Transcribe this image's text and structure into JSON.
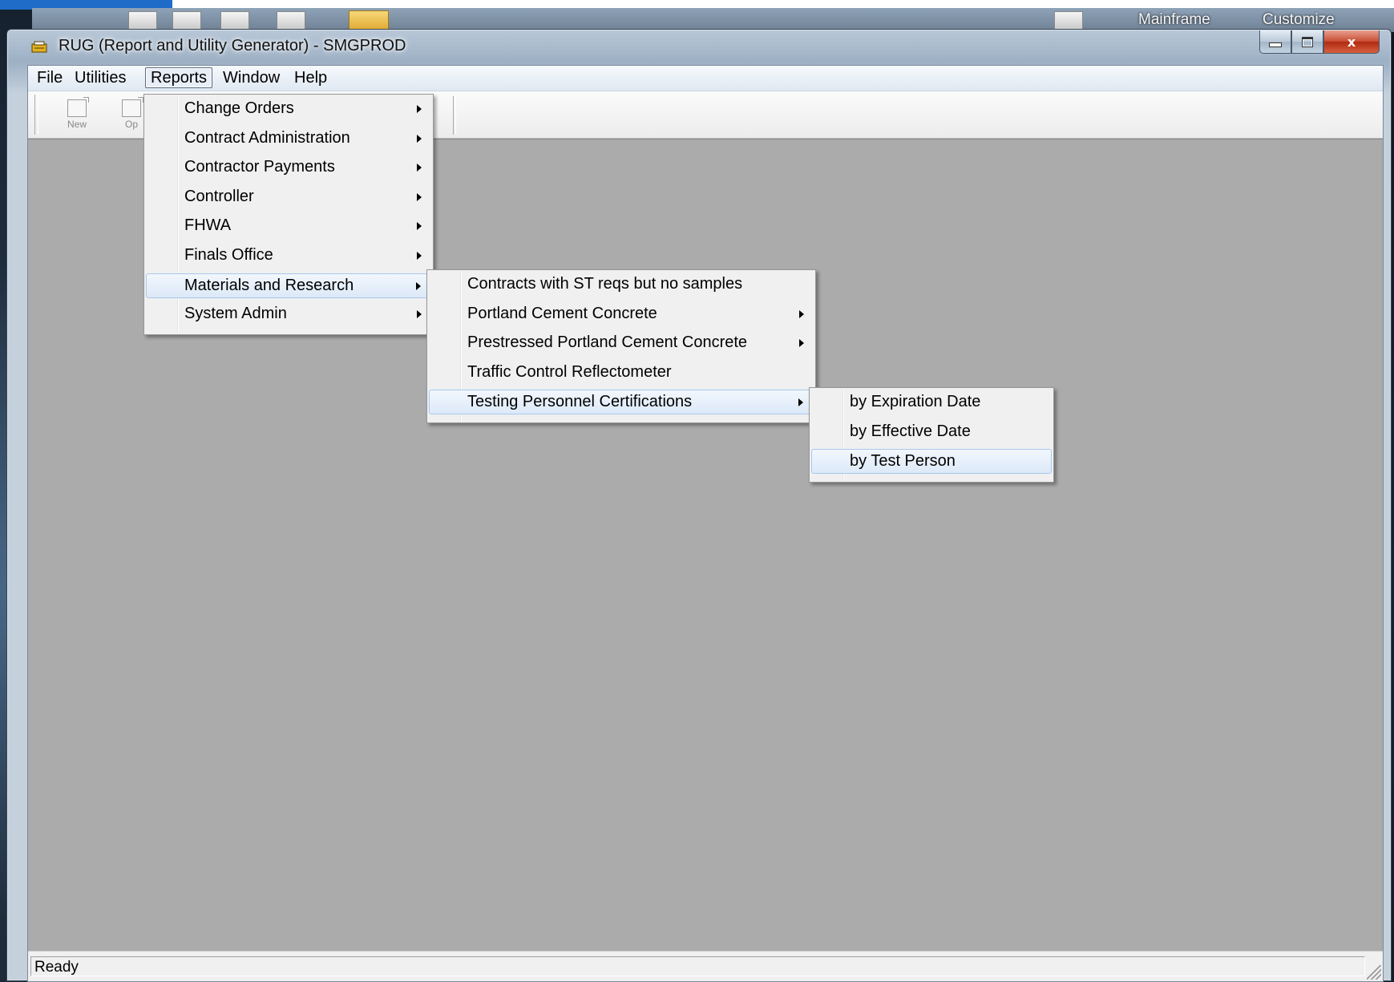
{
  "desktop": {
    "labels": [
      "Mainframe",
      "Customize"
    ]
  },
  "window": {
    "title": "RUG (Report and Utility Generator) - SMGPROD",
    "close_glyph": "x"
  },
  "menubar": {
    "items": [
      "File",
      "Utilities",
      "Reports",
      "Window",
      "Help"
    ]
  },
  "toolbar": {
    "buttons": [
      "New",
      "Op"
    ]
  },
  "reports_menu": {
    "items": [
      {
        "label": "Change Orders",
        "submenu": true
      },
      {
        "label": "Contract Administration",
        "submenu": true
      },
      {
        "label": "Contractor Payments",
        "submenu": true
      },
      {
        "label": "Controller",
        "submenu": true
      },
      {
        "label": "FHWA",
        "submenu": true
      },
      {
        "label": "Finals Office",
        "submenu": true
      },
      {
        "label": "Materials and Research",
        "submenu": true,
        "highlighted": true
      },
      {
        "label": "System Admin",
        "submenu": true
      }
    ]
  },
  "materials_menu": {
    "items": [
      {
        "label": "Contracts with ST reqs but no samples",
        "submenu": false
      },
      {
        "label": "Portland Cement Concrete",
        "submenu": true
      },
      {
        "label": "Prestressed Portland Cement Concrete",
        "submenu": true
      },
      {
        "label": "Traffic Control Reflectometer",
        "submenu": false
      },
      {
        "label": "Testing Personnel Certifications",
        "submenu": true,
        "highlighted": true
      }
    ]
  },
  "certifications_menu": {
    "items": [
      {
        "label": "by Expiration Date"
      },
      {
        "label": "by Effective Date"
      },
      {
        "label": "by Test Person",
        "highlighted": true
      }
    ]
  },
  "statusbar": {
    "text": "Ready"
  },
  "colors": {
    "workspace": "#ababab",
    "highlight_border": "#a8c8ec",
    "close_button": "#c84a30"
  }
}
